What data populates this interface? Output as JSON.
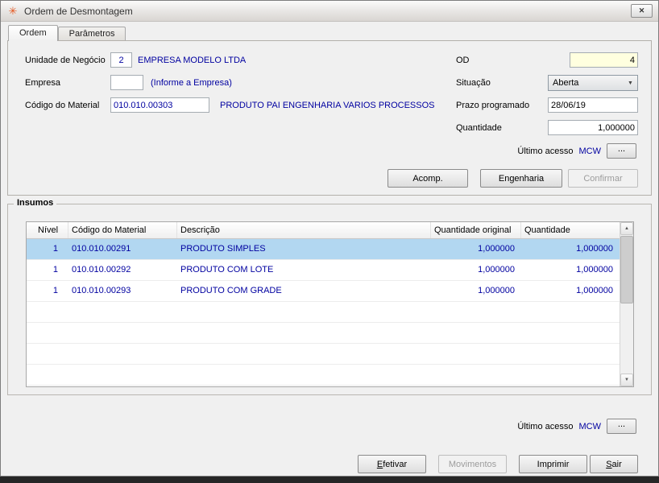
{
  "window": {
    "title": "Ordem de Desmontagem"
  },
  "icons": {
    "app": "✳",
    "close": "✕",
    "dropdown": "▼",
    "scroll_up": "▲",
    "scroll_down": "▼",
    "more": "..."
  },
  "colors": {
    "link_navy": "#0000a0",
    "selected_row": "#b2d7f1",
    "od_field_bg": "#ffffdf"
  },
  "tabs": {
    "ordem": "Ordem",
    "parametros": "Parâmetros"
  },
  "ordem": {
    "unidade_negocio": {
      "label": "Unidade de Negócio",
      "value": "2",
      "descricao": "EMPRESA MODELO LTDA"
    },
    "empresa": {
      "label": "Empresa",
      "value": "",
      "hint": "(Informe a Empresa)"
    },
    "codigo_material": {
      "label": "Código do Material",
      "value": "010.010.00303",
      "descricao": "PRODUTO PAI ENGENHARIA VARIOS PROCESSOS"
    },
    "od": {
      "label": "OD",
      "value": "4"
    },
    "situacao": {
      "label": "Situação",
      "value": "Aberta"
    },
    "prazo_programado": {
      "label": "Prazo programado",
      "value": "28/06/19"
    },
    "quantidade": {
      "label": "Quantidade",
      "value": "1,000000"
    },
    "ultimo_acesso": {
      "label": "Último acesso",
      "value": "MCW"
    },
    "botoes": {
      "acomp": "Acomp.",
      "engenharia": "Engenharia",
      "confirmar": "Confirmar"
    }
  },
  "insumos": {
    "titulo": "Insumos",
    "colunas": {
      "nivel": "Nível",
      "codigo": "Código do Material",
      "descricao": "Descrição",
      "quantidade_original": "Quantidade original",
      "quantidade": "Quantidade"
    },
    "rows": [
      {
        "nivel": "1",
        "codigo": "010.010.00291",
        "descricao": "PRODUTO SIMPLES",
        "quantidade_original": "1,000000",
        "quantidade": "1,000000",
        "selected": true
      },
      {
        "nivel": "1",
        "codigo": "010.010.00292",
        "descricao": "PRODUTO COM LOTE",
        "quantidade_original": "1,000000",
        "quantidade": "1,000000",
        "selected": false
      },
      {
        "nivel": "1",
        "codigo": "010.010.00293",
        "descricao": "PRODUTO COM GRADE",
        "quantidade_original": "1,000000",
        "quantidade": "1,000000",
        "selected": false
      }
    ],
    "ultimo_acesso": {
      "label": "Último acesso",
      "value": "MCW"
    }
  },
  "footer": {
    "efetivar": {
      "key": "E",
      "rest": "fetivar"
    },
    "movimentos": "Movimentos",
    "imprimir": "Imprimir",
    "sair": {
      "key": "S",
      "rest": "air"
    }
  }
}
